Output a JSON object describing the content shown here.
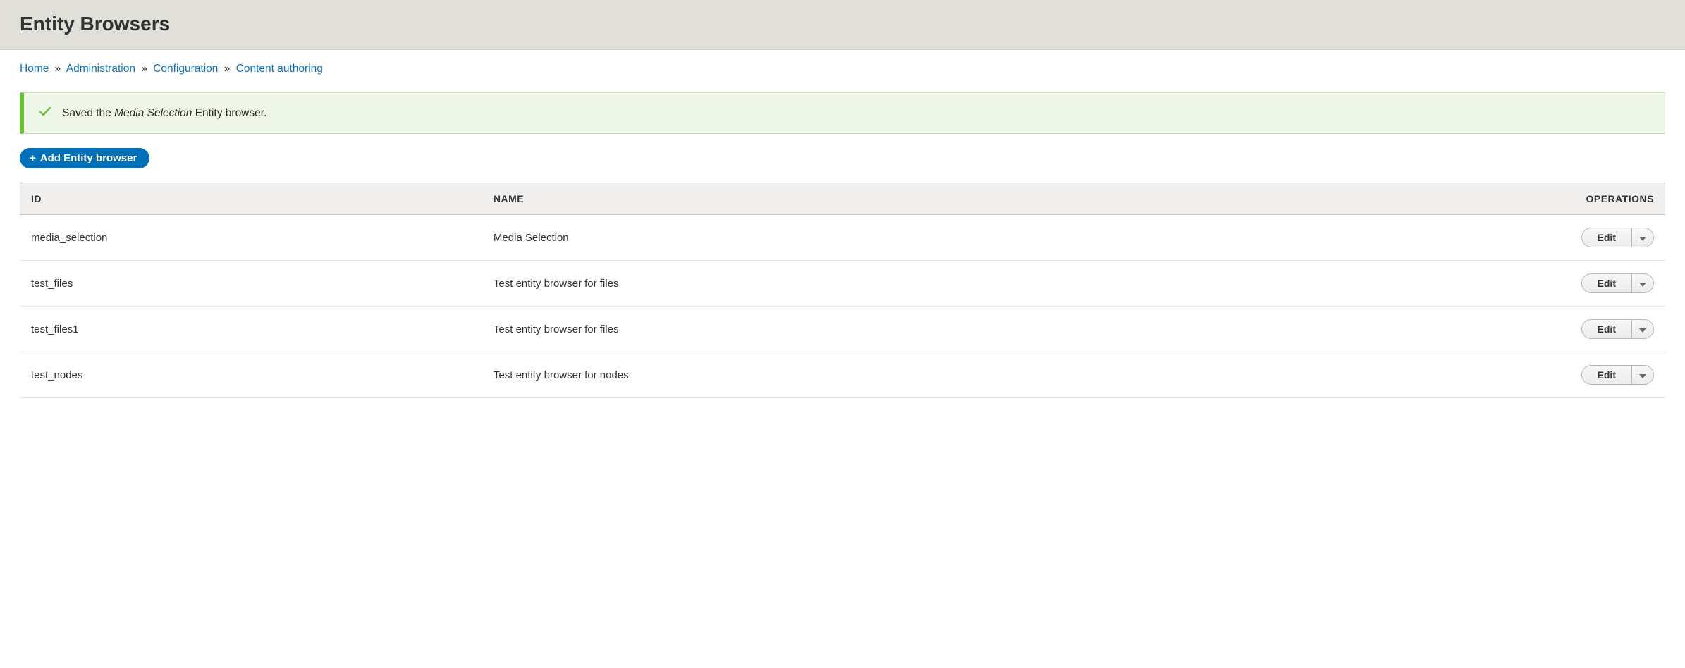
{
  "page_title": "Entity Browsers",
  "breadcrumb": {
    "items": [
      "Home",
      "Administration",
      "Configuration",
      "Content authoring"
    ],
    "separator": "»"
  },
  "message": {
    "prefix": "Saved the ",
    "emphasis": "Media Selection",
    "suffix": " Entity browser."
  },
  "add_button_label": "Add Entity browser",
  "table": {
    "headers": {
      "id": "ID",
      "name": "NAME",
      "operations": "OPERATIONS"
    },
    "edit_label": "Edit",
    "rows": [
      {
        "id": "media_selection",
        "name": "Media Selection"
      },
      {
        "id": "test_files",
        "name": "Test entity browser for files"
      },
      {
        "id": "test_files1",
        "name": "Test entity browser for files"
      },
      {
        "id": "test_nodes",
        "name": "Test entity browser for nodes"
      }
    ]
  }
}
